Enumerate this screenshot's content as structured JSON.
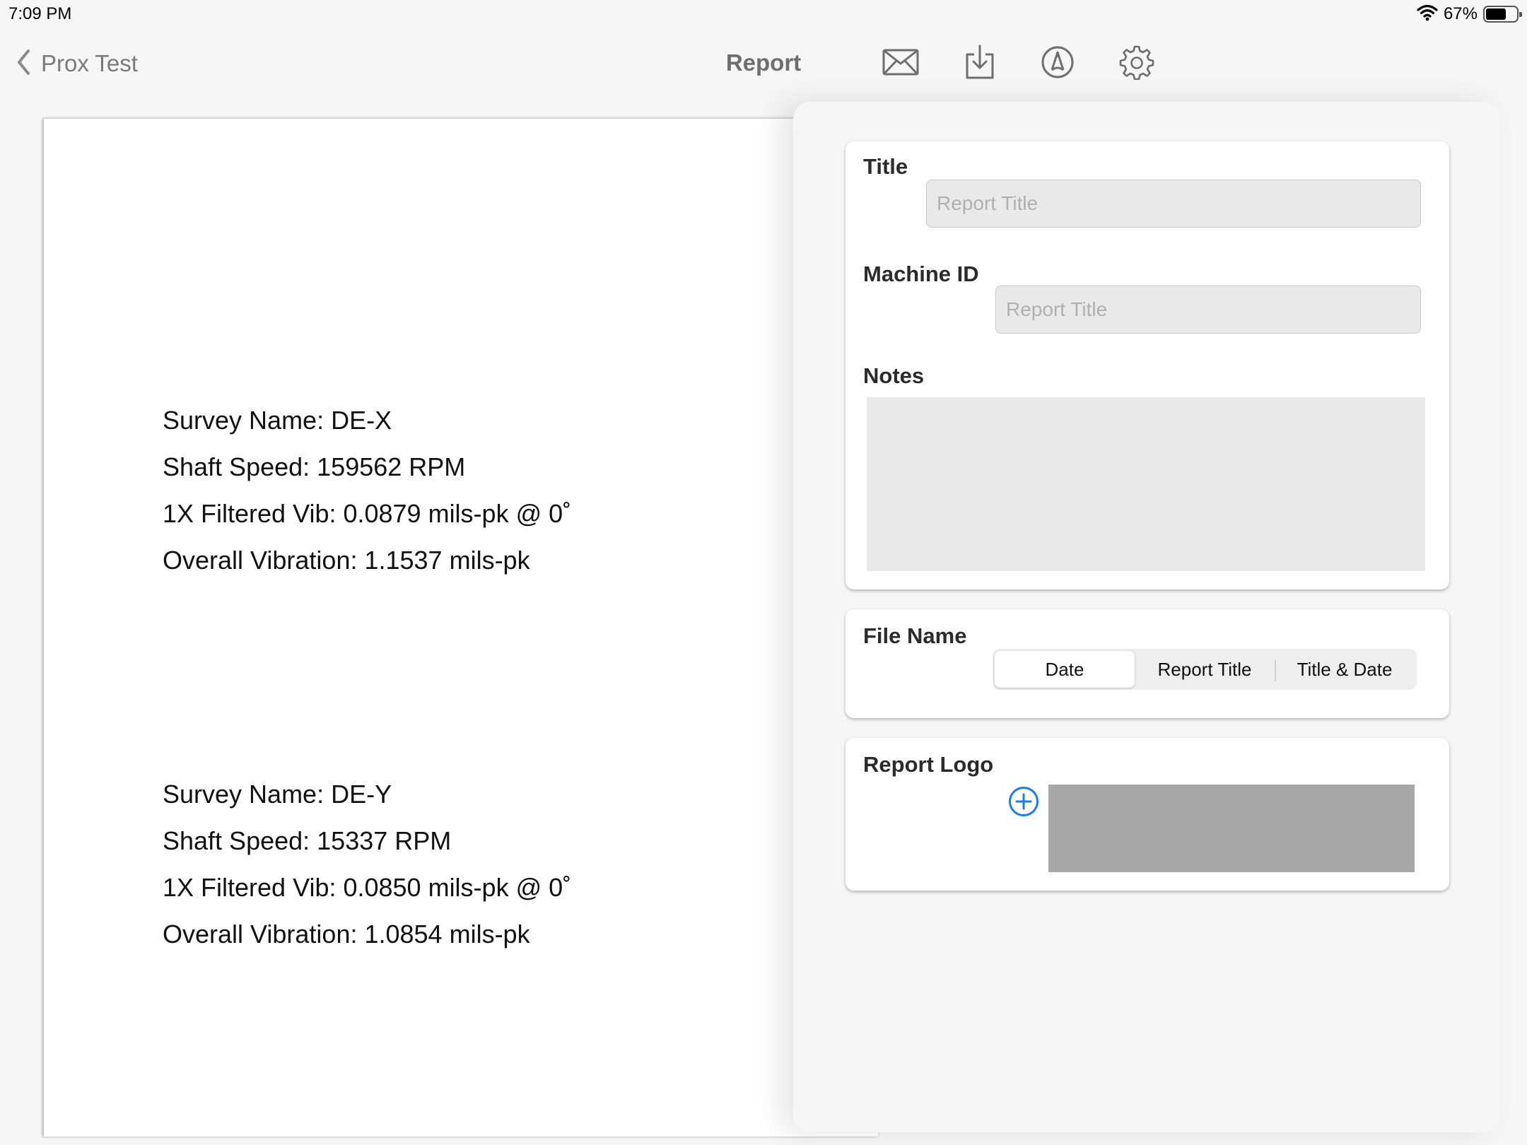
{
  "status_bar": {
    "time": "7:09 PM",
    "battery_percent": "67%",
    "battery_level": 0.67
  },
  "nav": {
    "back_label": "Prox Test",
    "title": "Report",
    "icons": [
      "mail-icon",
      "download-icon",
      "markup-icon",
      "gear-icon"
    ]
  },
  "document": {
    "surveys": [
      {
        "name_line": "Survey Name: DE-X",
        "speed_line": "Shaft Speed: 159562 RPM",
        "filtered_line": "1X Filtered Vib: 0.0879 mils-pk @ 0˚",
        "overall_line": "Overall Vibration: 1.1537 mils-pk"
      },
      {
        "name_line": "Survey Name: DE-Y",
        "speed_line": "Shaft Speed: 15337 RPM",
        "filtered_line": "1X Filtered Vib: 0.0850 mils-pk @ 0˚",
        "overall_line": "Overall Vibration: 1.0854 mils-pk"
      }
    ]
  },
  "settings": {
    "title_label": "Title",
    "title_placeholder": "Report Title",
    "title_value": "",
    "machine_id_label": "Machine ID",
    "machine_id_placeholder": "Report Title",
    "machine_id_value": "",
    "notes_label": "Notes",
    "notes_value": "",
    "file_name_label": "File Name",
    "file_name_options": [
      "Date",
      "Report Title",
      "Title & Date"
    ],
    "file_name_selected": "Date",
    "report_logo_label": "Report Logo"
  },
  "colors": {
    "accent": "#1a7cf5",
    "logo_placeholder": "#a8a8a8",
    "input_bg": "#e9e9e9"
  }
}
